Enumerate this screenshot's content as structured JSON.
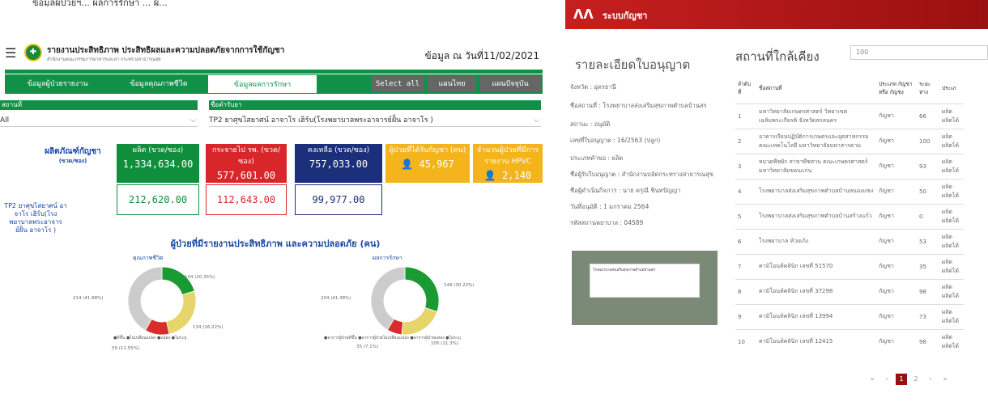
{
  "left": {
    "top_caption": "ข้อมูลผู้ป่วยฯ... ผลการรักษา ... ผู้...",
    "title": "รายงานประสิทธิภาพ ประสิทธิผลและความปลอดภัยจากการใช้กัญชา",
    "subtitle": "สำนักงานคณะกรรมการอาหารและยา กระทรวงสาธารณสุข",
    "date_text": "ข้อมูล ณ วันที่11/02/2021",
    "tabs": [
      "ข้อมูลผู้ป่วยรายงาน",
      "ข้อมูลคุณภาพชีวิต",
      "ข้อมูลผลการรักษา"
    ],
    "buttons": [
      "Select all",
      "แผนไทย",
      "แผนปัจจุบัน"
    ],
    "filter_place_label": "สถานที่",
    "filter_place_value": "All",
    "filter_drug_label": "ชื่อตำรับยา",
    "filter_drug_value": "TP2 ยาศุขไสยาศน์ อาจาโร เฮิร์บ(โรงพยาบาลพระอาจารย์ฝั้น อาจาโร )",
    "product_title": "ผลิตภัณฑ์กัญชา",
    "product_unit": "(ขวด/ซอง)",
    "cards": [
      {
        "label": "ผลิต (ขวด/ซอง)",
        "value": "1,334,634.00",
        "color": "#0f8f3c"
      },
      {
        "label": "กระจายไป รพ. (ขวด/ซอง)",
        "value": "577,601.00",
        "color": "#d9262b"
      },
      {
        "label": "คงเหลือ (ขวด/ซอง)",
        "value": "757,033.00",
        "color": "#1c2f7a"
      },
      {
        "label": "ผู้ป่วยที่ได้รับกัญชา (คน)",
        "value": "45,967",
        "color": "#f3b51b"
      },
      {
        "label": "จำนวนผู้ป่วยที่มีการรายงาน HPVC",
        "value": "2,140",
        "color": "#f3b51b"
      }
    ],
    "row_label": "TP2 ยาศุขไสยาศน์ อาจาโร เฮิร์บ(โรงพยาบาลพระอาจารย์ฝั้น อาจาโร )",
    "row_values": [
      "212,620.00",
      "112,643.00",
      "99,977.00"
    ],
    "chart_title": "ผู้ป่วยที่มีรายงานประสิทธิภาพ และความปลอดภัย (คน)",
    "chart1_head": "คุณภาพชีวิต",
    "chart2_head": "ผลการรักษา",
    "legend1": "●ดีขึ้น ●ไม่เปลี่ยนแปลง ●แย่ลง ●ไม่ระบุ",
    "legend2": "●อาการผู้ป่วยดีขึ้น ●อาการผู้ป่วยไม่เปลี่ยนแปลง ●อาการผู้ป่วยแย่ลง ●ไม่ระบุ"
  },
  "chart_data": [
    {
      "type": "pie",
      "title": "คุณภาพชีวิต",
      "labels": [
        "ดีขึ้น",
        "ไม่เปลี่ยนแปลง",
        "แย่ลง",
        "ไม่ระบุ"
      ],
      "values": [
        104,
        134,
        59,
        214
      ],
      "value_labels": [
        "104 (20.35%)",
        "134 (26.22%)",
        "59 (11.55%)",
        "214 (41.88%)"
      ],
      "colors": [
        "#1a9a32",
        "#e6d56a",
        "#d92b2b",
        "#cccccc"
      ]
    },
    {
      "type": "pie",
      "title": "ผลการรักษา",
      "labels": [
        "อาการผู้ป่วยดีขึ้น",
        "อาการผู้ป่วยไม่เปลี่ยนแปลง",
        "อาการผู้ป่วยแย่ลง",
        "ไม่ระบุ"
      ],
      "values": [
        149,
        105,
        35,
        204
      ],
      "value_labels": [
        "149 (30.22%)",
        "105 (21.3%)",
        "35 (7.1%)",
        "204 (41.38%)"
      ],
      "colors": [
        "#1a9a32",
        "#e6d56a",
        "#d92b2b",
        "#cccccc"
      ]
    }
  ],
  "right": {
    "app_title": "ระบบกัญชา",
    "license_heading": "รายละเอียดใบอนุญาต",
    "nearby_heading": "สถานที่ใกล้เคียง",
    "radius_value": "100",
    "info_lines": [
      "จังหวัด : อุดรธานี",
      "ชื่อสถานที่ : โรงพยาบาลส่งเสริมสุขภาพตำบลบ้านสร",
      "สถานะ : อนุมัติ",
      "เลขที่ใบอนุญาต : 16/2563 (ปลูก)",
      "ประเภทคำขอ : ผลิต",
      "ชื่อผู้รับใบอนุญาต : สำนักงานปลัดกระทรวงสาธารณสุข",
      "ชื่อผู้ดำเนินกิจการ : นาย ครุณี ชินทปัญญา",
      "วันที่อนุมัติ : 1 มกราคม 2564",
      "รหัสสถานพยาบาล : 04589"
    ],
    "map_popup": "โรงพยาบาลส่งเสริมสุขภาพตำบลบ้านสร",
    "table_headers": [
      "ลำดับ ที่",
      "ชื่อสถานที่",
      "ประเภท กัญชา หรือ กัญชง",
      "ระยะ ห่าง",
      "ประเภ"
    ],
    "rows": [
      [
        "1",
        "มหาวิทยาลัยเกษตรศาสตร์ วิทยาเขตเฉลิมพระเกียรติ จังหวัดสกลนคร",
        "กัญชา",
        "66",
        "ผลิต ผลิตได้"
      ],
      [
        "2",
        "อาคารเรียนปฏิบัติการเกษตรและอุตสาหกรรม คณะเทคโนโลยี มหาวิทยาลัยมหาสารคาม",
        "กัญชา",
        "100",
        "ผลิต ผลิตได้"
      ],
      [
        "3",
        "หมวดพืชผัก สาขาพืชสวน คณะเกษตรศาสตร์ มหาวิทยาลัยขอนแก่น",
        "กัญชา",
        "93",
        "ผลิต ผลิตได้"
      ],
      [
        "4",
        "โรงพยาบาลส่งเสริมสุขภาพตำบลบ้านหนองแซง",
        "กัญชา",
        "50",
        "ผลิต ผลิตได้"
      ],
      [
        "5",
        "โรงพยาบาลส่งเสริมสุขภาพตำบลบ้านสร้างแก้ว",
        "กัญชา",
        "0",
        "ผลิต ผลิตได้"
      ],
      [
        "6",
        "โรงพยาบาล ห้วยเก้ง",
        "กัญชา",
        "53",
        "ผลิต ผลิตได้"
      ],
      [
        "7",
        "คามิโอนท์คลินิก เลขที่ 51570",
        "กัญชา",
        "35",
        "ผลิต ผลิตได้"
      ],
      [
        "8",
        "คามิโอนท์คลินิก เลขที่ 37298",
        "กัญชา",
        "98",
        "ผลิต ผลิตได้"
      ],
      [
        "9",
        "คามิโอนท์คลินิก เลขที่ 13994",
        "กัญชา",
        "73",
        "ผลิต ผลิตได้"
      ],
      [
        "10",
        "คามิโอนท์คลินิก เลขที่ 12415",
        "กัญชา",
        "98",
        "ผลิต ผลิตได้"
      ]
    ],
    "pages": [
      "«",
      "‹",
      "1",
      "2",
      "›",
      "»"
    ]
  }
}
